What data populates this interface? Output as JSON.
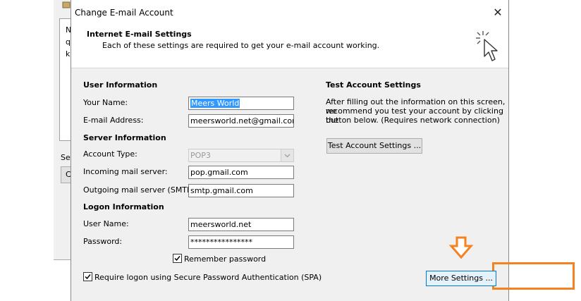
{
  "background_window": {
    "visible_chars": [
      "N",
      "q",
      "k"
    ],
    "sel_label": "Sel",
    "button_label": "C"
  },
  "dialog": {
    "title": "Change E-mail Account",
    "close_glyph": "✕",
    "header": {
      "title": "Internet E-mail Settings",
      "subtitle": "Each of these settings are required to get your e-mail account working."
    },
    "user_info": {
      "heading": "User Information",
      "name_label": "Your Name:",
      "name_value": "Meers World",
      "email_label": "E-mail Address:",
      "email_value": "meersworld.net@gmail.com"
    },
    "server_info": {
      "heading": "Server Information",
      "account_type_label": "Account Type:",
      "account_type_value": "POP3",
      "incoming_label": "Incoming mail server:",
      "incoming_value": "pop.gmail.com",
      "outgoing_label": "Outgoing mail server (SMTP):",
      "outgoing_value": "smtp.gmail.com"
    },
    "logon_info": {
      "heading": "Logon Information",
      "username_label": "User Name:",
      "username_value": "meersworld.net",
      "password_label": "Password:",
      "password_value": "****************",
      "remember_label": "Remember password",
      "remember_checked": true,
      "spa_label": "Require logon using Secure Password Authentication (SPA)",
      "spa_checked": true
    },
    "test_settings": {
      "heading": "Test Account Settings",
      "line1": "After filling out the information on this screen, we",
      "line2": "recommend you test your account by clicking the",
      "line3": "button below. (Requires network connection)",
      "button_label": "Test Account Settings ..."
    },
    "more_settings_label": "More Settings ...",
    "highlight_color": "#f58220",
    "selection_color": "#3399ff"
  }
}
